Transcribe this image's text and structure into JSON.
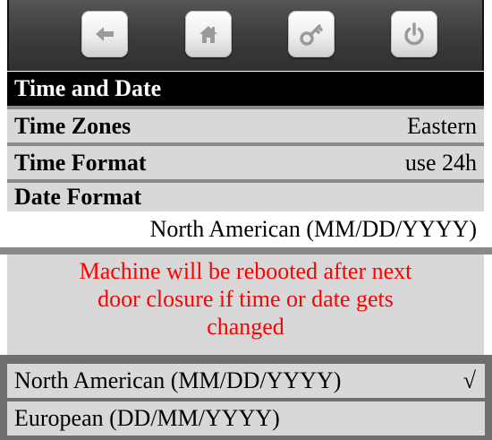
{
  "toolbar": {
    "buttons": [
      {
        "icon": "arrow-left-icon"
      },
      {
        "icon": "home-icon"
      },
      {
        "icon": "key-icon"
      },
      {
        "icon": "power-icon"
      }
    ]
  },
  "section_title": "Time and Date",
  "settings": {
    "time_zones": {
      "label": "Time Zones",
      "value": "Eastern"
    },
    "time_format": {
      "label": "Time Format",
      "value": "use 24h"
    },
    "date_format": {
      "label": "Date Format",
      "value": "North American (MM/DD/YYYY)"
    }
  },
  "warning": {
    "line1": "Machine will be rebooted after next",
    "line2": "door closure if time or date gets",
    "line3": "changed",
    "color": "#ff0000"
  },
  "date_options": [
    {
      "label": "North American (MM/DD/YYYY)",
      "mark": "√"
    },
    {
      "label": "European (DD/MM/YYYY)",
      "mark": ""
    }
  ]
}
